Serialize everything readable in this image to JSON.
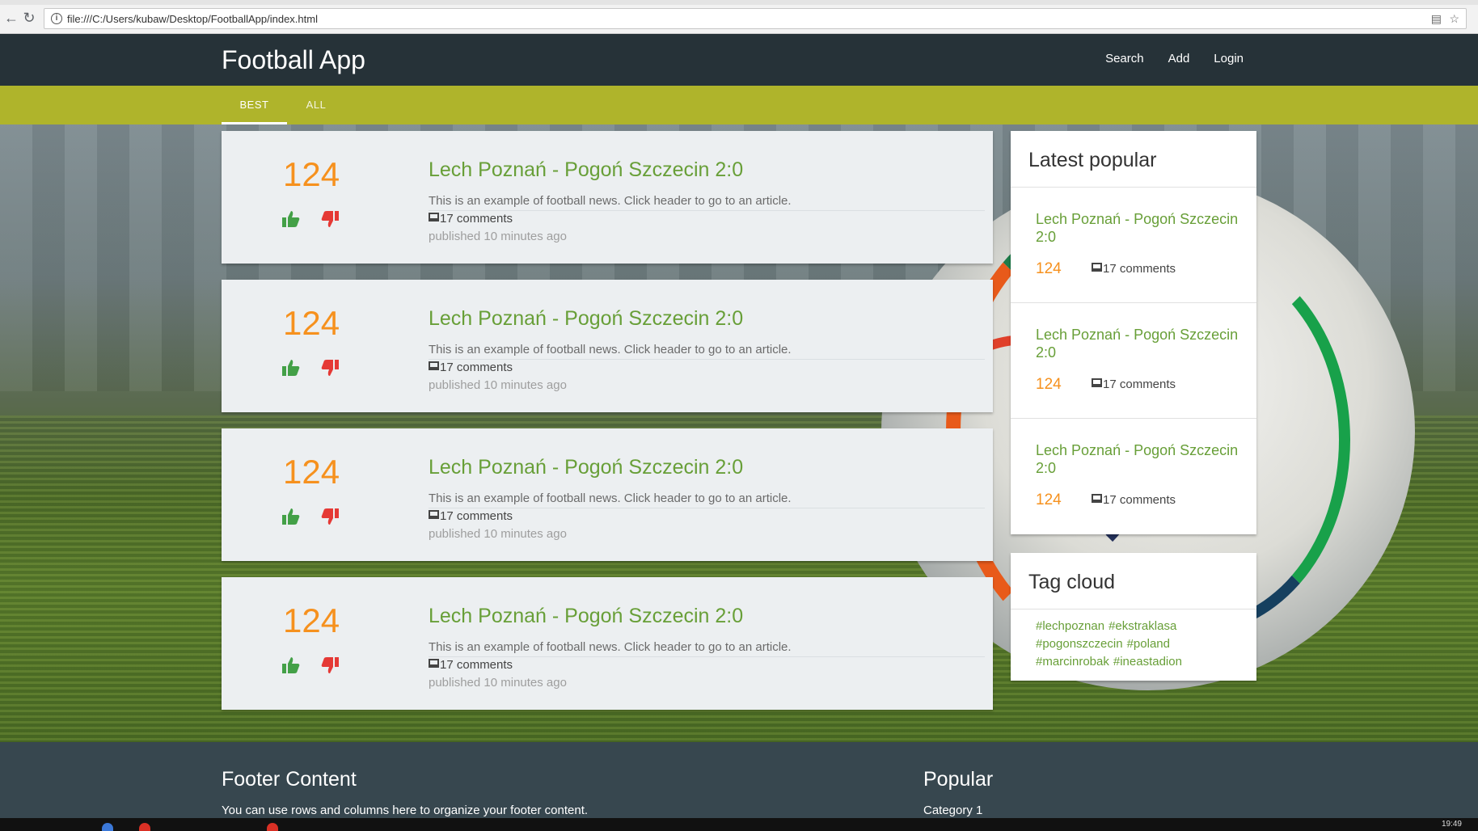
{
  "browser": {
    "url": "file:///C:/Users/kubaw/Desktop/FootballApp/index.html",
    "back_icon": "back-arrow-icon",
    "reload_icon": "reload-icon"
  },
  "header": {
    "brand": "Football App",
    "nav": [
      "Search",
      "Add",
      "Login"
    ]
  },
  "tabs": [
    {
      "label": "BEST",
      "active": true
    },
    {
      "label": "ALL",
      "active": false
    }
  ],
  "posts": [
    {
      "score": "124",
      "title": "Lech Poznań - Pogoń Szczecin 2:0",
      "description": "This is an example of football news. Click header to go to an article.",
      "comments": "17 comments",
      "published": "published 10 minutes ago"
    },
    {
      "score": "124",
      "title": "Lech Poznań - Pogoń Szczecin 2:0",
      "description": "This is an example of football news. Click header to go to an article.",
      "comments": "17 comments",
      "published": "published 10 minutes ago"
    },
    {
      "score": "124",
      "title": "Lech Poznań - Pogoń Szczecin 2:0",
      "description": "This is an example of football news. Click header to go to an article.",
      "comments": "17 comments",
      "published": "published 10 minutes ago"
    },
    {
      "score": "124",
      "title": "Lech Poznań - Pogoń Szczecin 2:0",
      "description": "This is an example of football news. Click header to go to an article.",
      "comments": "17 comments",
      "published": "published 10 minutes ago"
    }
  ],
  "sidebar": {
    "latest_title": "Latest popular",
    "latest": [
      {
        "title": "Lech Poznań - Pogoń Szczecin 2:0",
        "score": "124",
        "comments": "17 comments"
      },
      {
        "title": "Lech Poznań - Pogoń Szczecin 2:0",
        "score": "124",
        "comments": "17 comments"
      },
      {
        "title": "Lech Poznań - Pogoń Szczecin 2:0",
        "score": "124",
        "comments": "17 comments"
      }
    ],
    "tagcloud_title": "Tag cloud",
    "tags": [
      "#lechpoznan",
      "#ekstraklasa",
      "#pogonszczecin",
      "#poland",
      "#marcinrobak",
      "#ineastadion"
    ]
  },
  "footer": {
    "left_title": "Footer Content",
    "left_text": "You can use rows and columns here to organize your footer content.",
    "right_title": "Popular",
    "right_text": "Category 1"
  },
  "taskbar": {
    "clock": "19:49"
  },
  "colors": {
    "header_bg": "#263238",
    "tabbar_bg": "#afb42b",
    "score": "#f6911e",
    "link_green": "#689f38",
    "upvote": "#43a047",
    "downvote": "#e53935",
    "footer_bg": "#37474f"
  }
}
